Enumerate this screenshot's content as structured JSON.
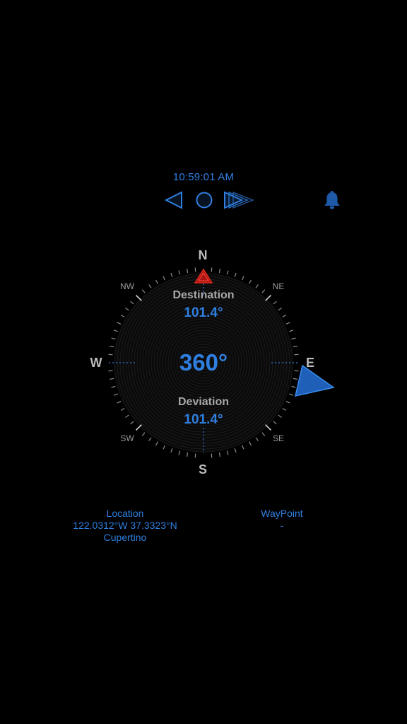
{
  "clock": {
    "time": "10:59:01 AM"
  },
  "controls": {
    "prev_icon": "triangle-left-icon",
    "stop_icon": "circle-icon",
    "next_icon": "fast-forward-icon",
    "alarm_icon": "bell-icon"
  },
  "compass": {
    "cardinals": {
      "n": "N",
      "e": "E",
      "s": "S",
      "w": "W"
    },
    "intercardinals": {
      "ne": "NE",
      "se": "SE",
      "sw": "SW",
      "nw": "NW"
    },
    "destination_label": "Destination",
    "destination_value": "101.4°",
    "heading_value": "360°",
    "deviation_label": "Deviation",
    "deviation_value": "101.4°",
    "heading_deg": 360,
    "destination_bearing_deg": 101.4
  },
  "location": {
    "label": "Location",
    "coords": "122.0312°W 37.3323°N",
    "city": "Cupertino"
  },
  "waypoint": {
    "label": "WayPoint",
    "value": "-"
  },
  "colors": {
    "accent": "#2f7fe0",
    "north_marker": "#d0201a",
    "label_gray": "#a8a8a8",
    "background": "#000000"
  }
}
